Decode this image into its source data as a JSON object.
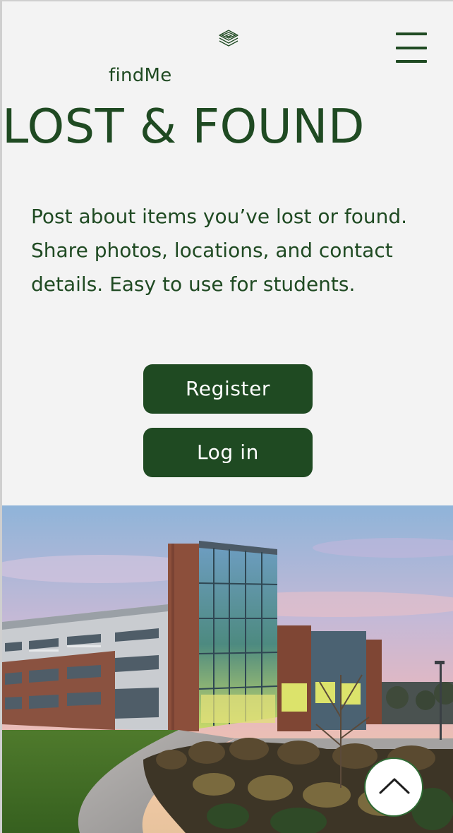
{
  "header": {
    "brand_name": "findMe",
    "logo_icon": "stacked-layers-icon",
    "menu_icon": "hamburger-menu-icon"
  },
  "hero_text": {
    "title": "LOST & FOUND",
    "description": "Post about items you’ve lost or found. Share photos, locations, and contact details. Easy to use for students."
  },
  "actions": {
    "register_label": "Register",
    "login_label": "Log in"
  },
  "image": {
    "subject": "campus-building-photo"
  },
  "scroll_top": {
    "icon": "chevron-up-icon"
  },
  "colors": {
    "brand_green": "#1f4a22",
    "background": "#f3f3f3",
    "button_text": "#ffffff"
  }
}
